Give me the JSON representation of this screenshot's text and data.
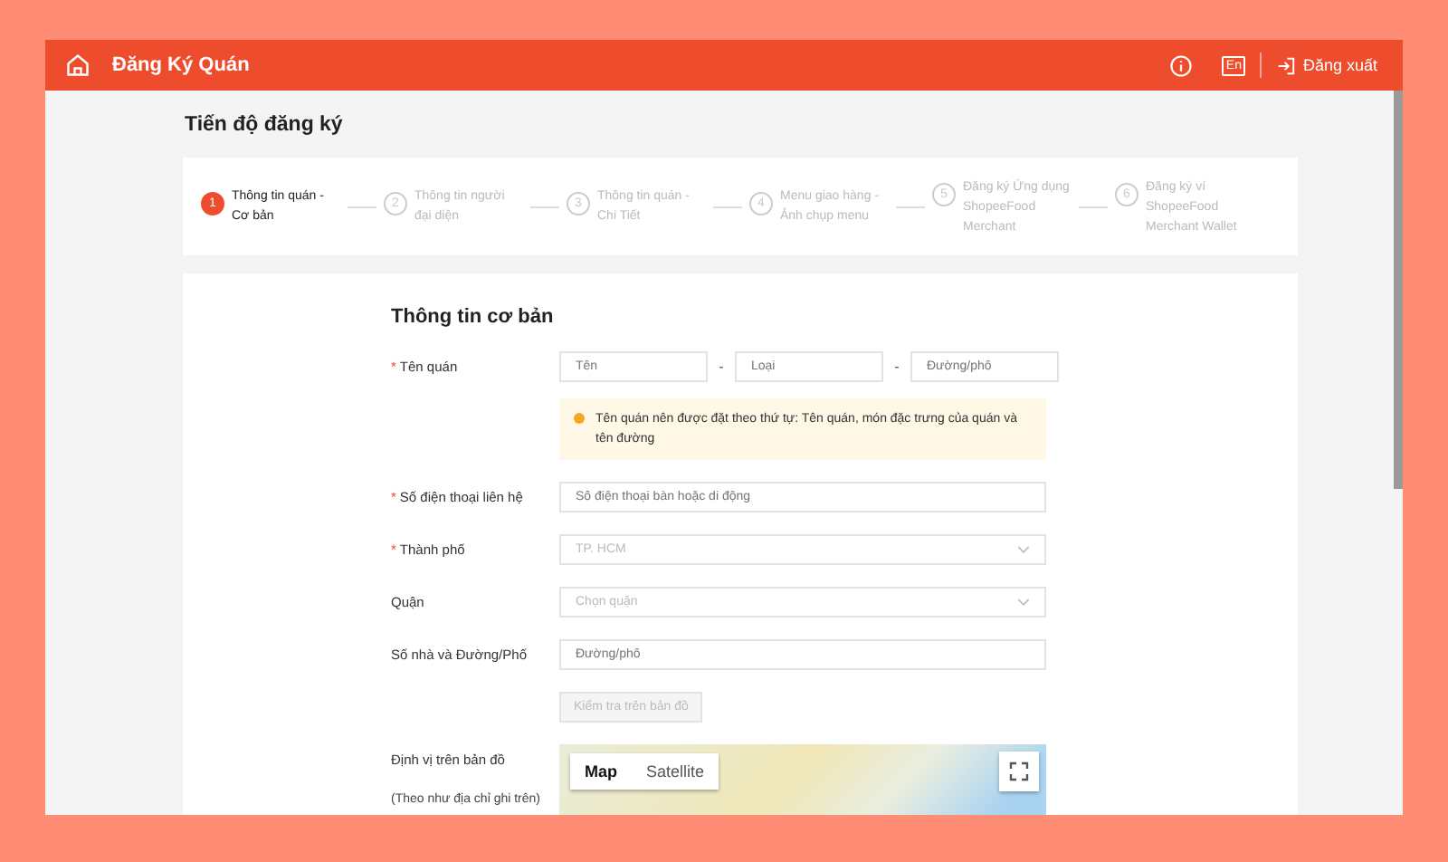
{
  "header": {
    "title": "Đăng Ký Quán",
    "language": "En",
    "logout": "Đăng xuất"
  },
  "progress_title": "Tiến độ đăng ký",
  "steps": [
    {
      "number": "1",
      "label": "Thông tin quán - Cơ bản",
      "selected": true
    },
    {
      "number": "2",
      "label": "Thông tin người đại diện",
      "selected": false
    },
    {
      "number": "3",
      "label": "Thông tin quán - Chi Tiết",
      "selected": false
    },
    {
      "number": "4",
      "label": "Menu giao hàng - Ảnh chụp menu",
      "selected": false
    },
    {
      "number": "5",
      "label": "Đăng ký Ứng dụng ShopeeFood Merchant",
      "selected": false
    },
    {
      "number": "6",
      "label": "Đăng ký ví ShopeeFood Merchant Wallet",
      "selected": false
    }
  ],
  "form": {
    "title": "Thông tin cơ bản",
    "rows": [
      {
        "kind": "triple",
        "label": "Tên quán",
        "required_mark": "*",
        "placeholders": [
          "Tên",
          "Loại",
          "Đường/phố"
        ],
        "separators": [
          "-",
          "-"
        ]
      },
      {
        "kind": "hint",
        "text": "Tên quán nên được đặt theo thứ tự: Tên quán, món đặc trưng của quán và tên đường"
      },
      {
        "kind": "text",
        "label": "Số điện thoại liên hệ",
        "required_mark": "*",
        "placeholder": "Số điện thoại bàn hoặc di động"
      },
      {
        "kind": "select",
        "label": "Thành phố",
        "required_mark": "*",
        "placeholder": "TP. HCM"
      },
      {
        "kind": "select",
        "label": "Quận",
        "placeholder": "Chọn quận"
      },
      {
        "kind": "text",
        "label": "Số nhà và Đường/Phố",
        "placeholder": "Đường/phố"
      },
      {
        "kind": "button",
        "label": "Kiểm tra trên bản đồ",
        "disabled": true
      },
      {
        "kind": "map",
        "label": "Định vị trên bản đồ",
        "sublabel": "(Theo như địa chỉ ghi trên)",
        "map_tabs": [
          {
            "label": "Map",
            "selected": true
          },
          {
            "label": "Satellite",
            "selected": false
          }
        ]
      }
    ]
  }
}
